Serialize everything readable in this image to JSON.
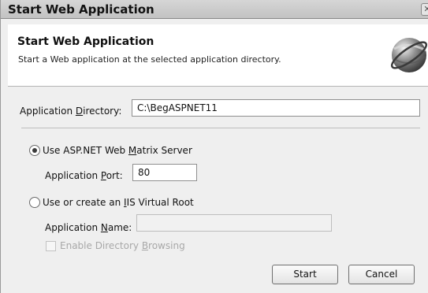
{
  "window": {
    "title": "Start Web Application",
    "close_glyph": "✕",
    "close_icon": "close-icon"
  },
  "header": {
    "title": "Start Web Application",
    "subtitle": "Start a Web application at the selected application directory.",
    "icon": "globe-icon"
  },
  "form": {
    "directory_label_pre": "Application ",
    "directory_label_mnemonic": "D",
    "directory_label_post": "irectory:",
    "directory_value": "C:\\BegASPNET11",
    "option_matrix": {
      "label_pre": "Use ASP.NET Web ",
      "label_mnemonic": "M",
      "label_post": "atrix Server",
      "selected": true
    },
    "port_label_pre": "Application ",
    "port_label_mnemonic": "P",
    "port_label_post": "ort:",
    "port_value": "80",
    "option_iis": {
      "label_pre": "Use or create an ",
      "label_mnemonic": "I",
      "label_post": "IS Virtual Root",
      "selected": false
    },
    "name_label_pre": "Application ",
    "name_label_mnemonic": "N",
    "name_label_post": "ame:",
    "name_value": "",
    "browsing_label_pre": "Enable Directory ",
    "browsing_label_mnemonic": "B",
    "browsing_label_post": "rowsing",
    "browsing_checked": false,
    "browsing_enabled": false
  },
  "buttons": {
    "start": "Start",
    "cancel": "Cancel"
  }
}
